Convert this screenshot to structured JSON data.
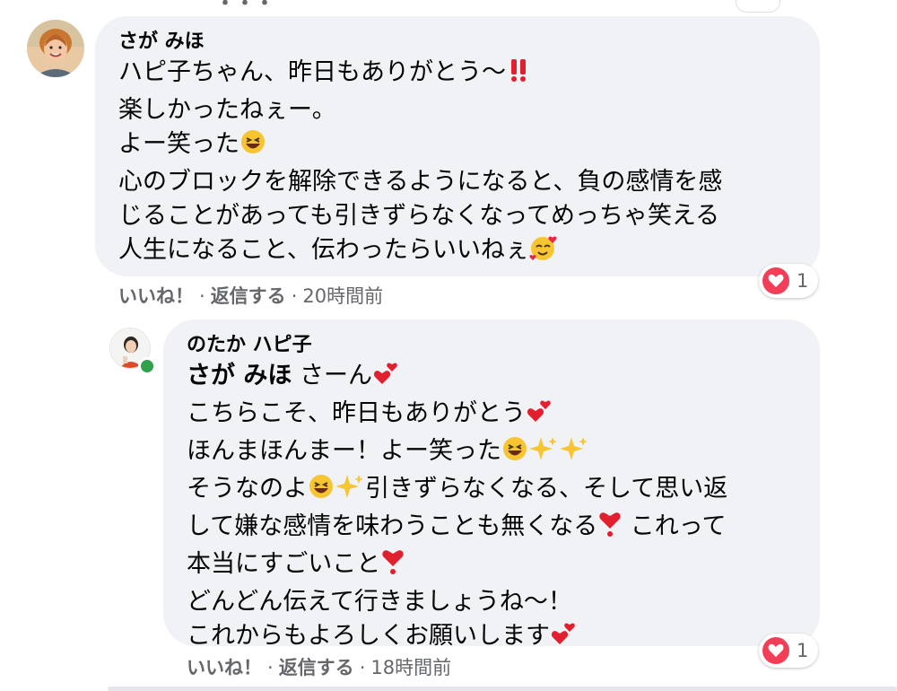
{
  "comment1": {
    "author": "さが みほ",
    "lines": [
      "ハピ子ちゃん、昨日もありがとう〜",
      "楽しかったねぇー。",
      "よー笑った",
      "心のブロックを解除できるようになると、負の感情を感",
      "じることがあっても引きずらなくなってめっちゃ笑える",
      "人生になること、伝わったらいいねぇ"
    ],
    "actions": {
      "like": "いいね！",
      "reply": "返信する",
      "time": "20時間前"
    },
    "reaction": {
      "icon": "heart-icon",
      "count": "1"
    }
  },
  "comment2": {
    "author": "のたか ハピ子",
    "mention": "さが みほ",
    "lines": [
      "さーん",
      "こちらこそ、昨日もありがとう",
      "ほんまほんまー！よー笑った",
      "そうなのよ",
      "引きずらなくなる、そして思い返",
      "して嫌な感情を味わうことも無くなる",
      "これって",
      "本当にすごいこと",
      "どんどん伝えて行きましょうね〜！",
      "これからもよろしくお願いします"
    ],
    "actions": {
      "like": "いいね！",
      "reply": "返信する",
      "time": "18時間前"
    },
    "reaction": {
      "icon": "heart-icon",
      "count": "1"
    }
  },
  "colors": {
    "bubble": "#f0f2f5",
    "meta_text": "#65676b",
    "heart": "#f33e58",
    "online": "#31a24c"
  }
}
